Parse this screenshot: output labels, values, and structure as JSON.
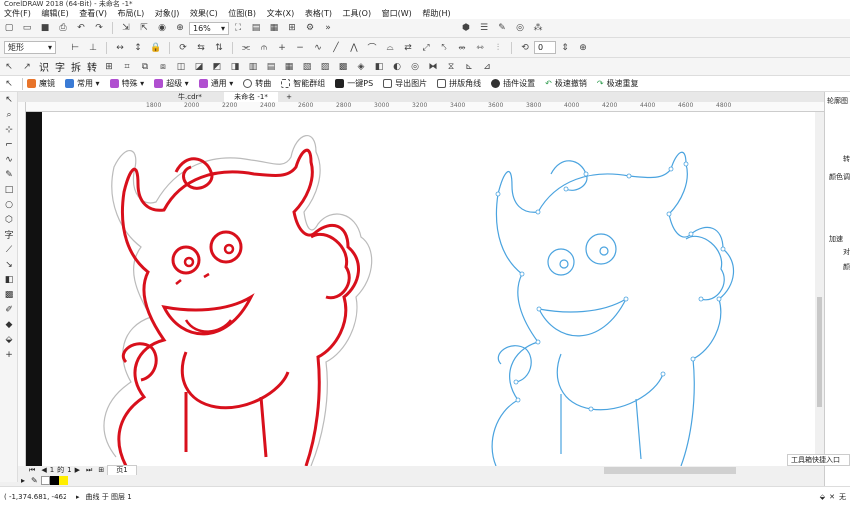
{
  "window": {
    "title": "CorelDRAW 2018 (64-Bit) - 未命名 -1*"
  },
  "menu": [
    "文件(F)",
    "编辑(E)",
    "查看(V)",
    "布局(L)",
    "对象(J)",
    "效果(C)",
    "位图(B)",
    "文本(X)",
    "表格(T)",
    "工具(O)",
    "窗口(W)",
    "帮助(H)"
  ],
  "standard_toolbar": {
    "zoom": "16%"
  },
  "property_bar": {
    "shape_select": "矩形",
    "counter": "0"
  },
  "tool_row": {
    "labels": [
      "识",
      "字",
      "拆",
      "转"
    ]
  },
  "plugin_bar": {
    "items": [
      {
        "label": "魔镜",
        "color": "#e8742a"
      },
      {
        "label": "常用",
        "color": "#3a7bd5",
        "dropdown": true
      },
      {
        "label": "特殊",
        "color": "#b04fd0",
        "dropdown": true
      },
      {
        "label": "超级",
        "color": "#b04fd0",
        "dropdown": true
      },
      {
        "label": "通用",
        "color": "#b04fd0",
        "dropdown": true
      },
      {
        "label": "转曲",
        "color": "#555555"
      },
      {
        "label": "智能群组",
        "color": "#555555"
      },
      {
        "label": "一键PS",
        "color": "#555555"
      },
      {
        "label": "导出图片",
        "color": "#555555"
      },
      {
        "label": "拼版角线",
        "color": "#555555"
      },
      {
        "label": "插件设置",
        "color": "#333333"
      },
      {
        "label": "极速撤销",
        "color": "#2a9a4a"
      },
      {
        "label": "极速重复",
        "color": "#2a9a4a"
      }
    ]
  },
  "document_tabs": [
    {
      "label": "牛.cdr*",
      "active": false
    },
    {
      "label": "未命名 -1*",
      "active": true
    }
  ],
  "ruler": {
    "ticks": [
      "1800",
      "2000",
      "2200",
      "2400",
      "2600",
      "2800",
      "3000",
      "3200",
      "3400",
      "3600",
      "3800",
      "4000",
      "4200",
      "4400",
      "4600",
      "4800"
    ]
  },
  "page_nav": {
    "current": "1",
    "of_label": "的",
    "total": "1",
    "page_tab": "页1"
  },
  "docker": {
    "title": "轮廓图",
    "labels": [
      "转",
      "颜色调",
      "加速",
      "对",
      "颜"
    ]
  },
  "quick_entry": "工具箱快捷入口",
  "status": {
    "coords": "( -1,374.681, -462.2...",
    "object_info": "曲线 于 图层 1",
    "fill_label": "无"
  },
  "colors": {
    "red_outline": "#d8101c",
    "blue_outline": "#4aa3df"
  }
}
